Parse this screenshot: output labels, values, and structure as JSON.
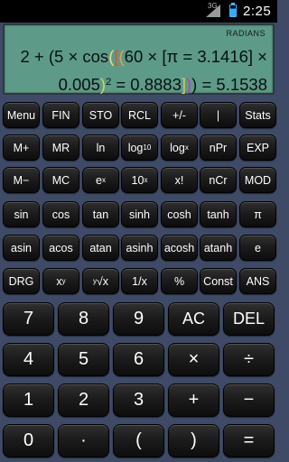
{
  "status_bar": {
    "network": "3G",
    "time": "2:25"
  },
  "display": {
    "mode": "RADIANS",
    "expression_parts": {
      "t1": "2 + (5 × cos",
      "t2": "(",
      "t3": "[",
      "t4": "(",
      "t5": "60 × [π = 3.1416] ×",
      "t6": "0.005",
      "t7": ")",
      "t8": "2",
      "t9": " = 0.8883",
      "t10": "]",
      "t11": ")",
      "t12": ") = 5.1538"
    }
  },
  "keys": {
    "menu": "Menu",
    "fin": "FIN",
    "sto": "STO",
    "rcl": "RCL",
    "neg": "+/-",
    "abs": "|",
    "stats": "Stats",
    "mplus": "M+",
    "mr": "MR",
    "ln": "ln",
    "log10_base": "log",
    "log10_sub": "10",
    "logx_base": "log",
    "logx_sub": "x",
    "npr": "nPr",
    "exp": "EXP",
    "mminus": "M−",
    "mc": "MC",
    "ex_base": "e",
    "ex_sup": "x",
    "tenx_base": "10",
    "tenx_sup": "x",
    "fact": "x!",
    "ncr": "nCr",
    "mod": "MOD",
    "sin": "sin",
    "cos": "cos",
    "tan": "tan",
    "sinh": "sinh",
    "cosh": "cosh",
    "tanh": "tanh",
    "pi": "π",
    "asin": "asin",
    "acos": "acos",
    "atan": "atan",
    "asinh": "asinh",
    "acosh": "acosh",
    "atanh": "atanh",
    "e": "e",
    "drg": "DRG",
    "xy_base": "x",
    "xy_sup": "y",
    "root_pre": "y",
    "root_main": "√x",
    "recip": "1/x",
    "pct": "%",
    "const": "Const",
    "ans": "ANS",
    "d7": "7",
    "d8": "8",
    "d9": "9",
    "ac": "AC",
    "del": "DEL",
    "d4": "4",
    "d5": "5",
    "d6": "6",
    "mul": "×",
    "div": "÷",
    "d1": "1",
    "d2": "2",
    "d3": "3",
    "add": "+",
    "sub": "−",
    "d0": "0",
    "dot": "·",
    "lparen": "(",
    "rparen": ")",
    "eq": "="
  }
}
